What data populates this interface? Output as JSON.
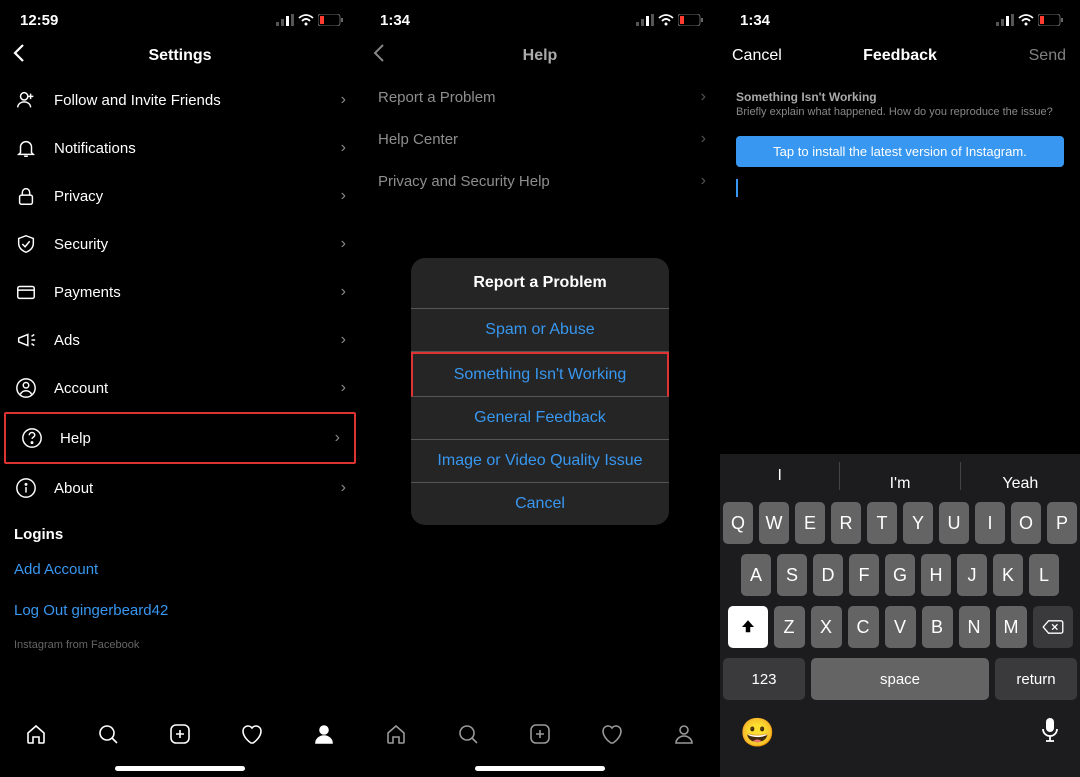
{
  "phone1": {
    "time": "12:59",
    "title": "Settings",
    "items": [
      {
        "label": "Follow and Invite Friends"
      },
      {
        "label": "Notifications"
      },
      {
        "label": "Privacy"
      },
      {
        "label": "Security"
      },
      {
        "label": "Payments"
      },
      {
        "label": "Ads"
      },
      {
        "label": "Account"
      },
      {
        "label": "Help"
      },
      {
        "label": "About"
      }
    ],
    "logins_header": "Logins",
    "add_account": "Add Account",
    "logout": "Log Out gingerbeard42",
    "footer": "Instagram from Facebook"
  },
  "phone2": {
    "time": "1:34",
    "title": "Help",
    "items": [
      {
        "label": "Report a Problem"
      },
      {
        "label": "Help Center"
      },
      {
        "label": "Privacy and Security Help"
      }
    ],
    "sheet": {
      "title": "Report a Problem",
      "options": [
        "Spam or Abuse",
        "Something Isn't Working",
        "General Feedback",
        "Image or Video Quality Issue",
        "Cancel"
      ]
    }
  },
  "phone3": {
    "time": "1:34",
    "cancel": "Cancel",
    "title": "Feedback",
    "send": "Send",
    "heading": "Something Isn't Working",
    "subtitle": "Briefly explain what happened. How do you reproduce the issue?",
    "banner": "Tap to install the latest version of Instagram.",
    "suggestions": [
      "I",
      "I'm",
      "Yeah"
    ],
    "kb_row1": [
      "Q",
      "W",
      "E",
      "R",
      "T",
      "Y",
      "U",
      "I",
      "O",
      "P"
    ],
    "kb_row2": [
      "A",
      "S",
      "D",
      "F",
      "G",
      "H",
      "J",
      "K",
      "L"
    ],
    "kb_row3": [
      "Z",
      "X",
      "C",
      "V",
      "B",
      "N",
      "M"
    ],
    "kb123": "123",
    "kb_space": "space",
    "kb_return": "return"
  }
}
